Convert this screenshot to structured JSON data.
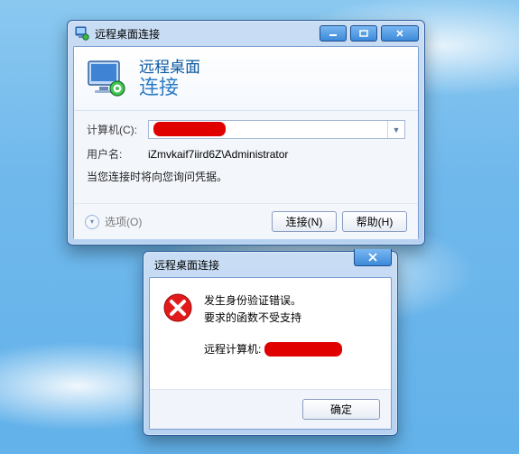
{
  "main": {
    "title": "远程桌面连接",
    "banner": {
      "line1": "远程桌面",
      "line2": "连接"
    },
    "labels": {
      "computer": "计算机(C):",
      "username": "用户名:"
    },
    "fields": {
      "computer_value": "",
      "username_value": "iZmvkaif7iird6Z\\Administrator"
    },
    "note": "当您连接时将向您询问凭据。",
    "options_label": "选项(O)",
    "buttons": {
      "connect": "连接(N)",
      "help": "帮助(H)"
    }
  },
  "dialog": {
    "title": "远程桌面连接",
    "error_line1": "发生身份验证错误。",
    "error_line2": "要求的函数不受支持",
    "remote_label": "远程计算机:",
    "ok": "确定"
  }
}
